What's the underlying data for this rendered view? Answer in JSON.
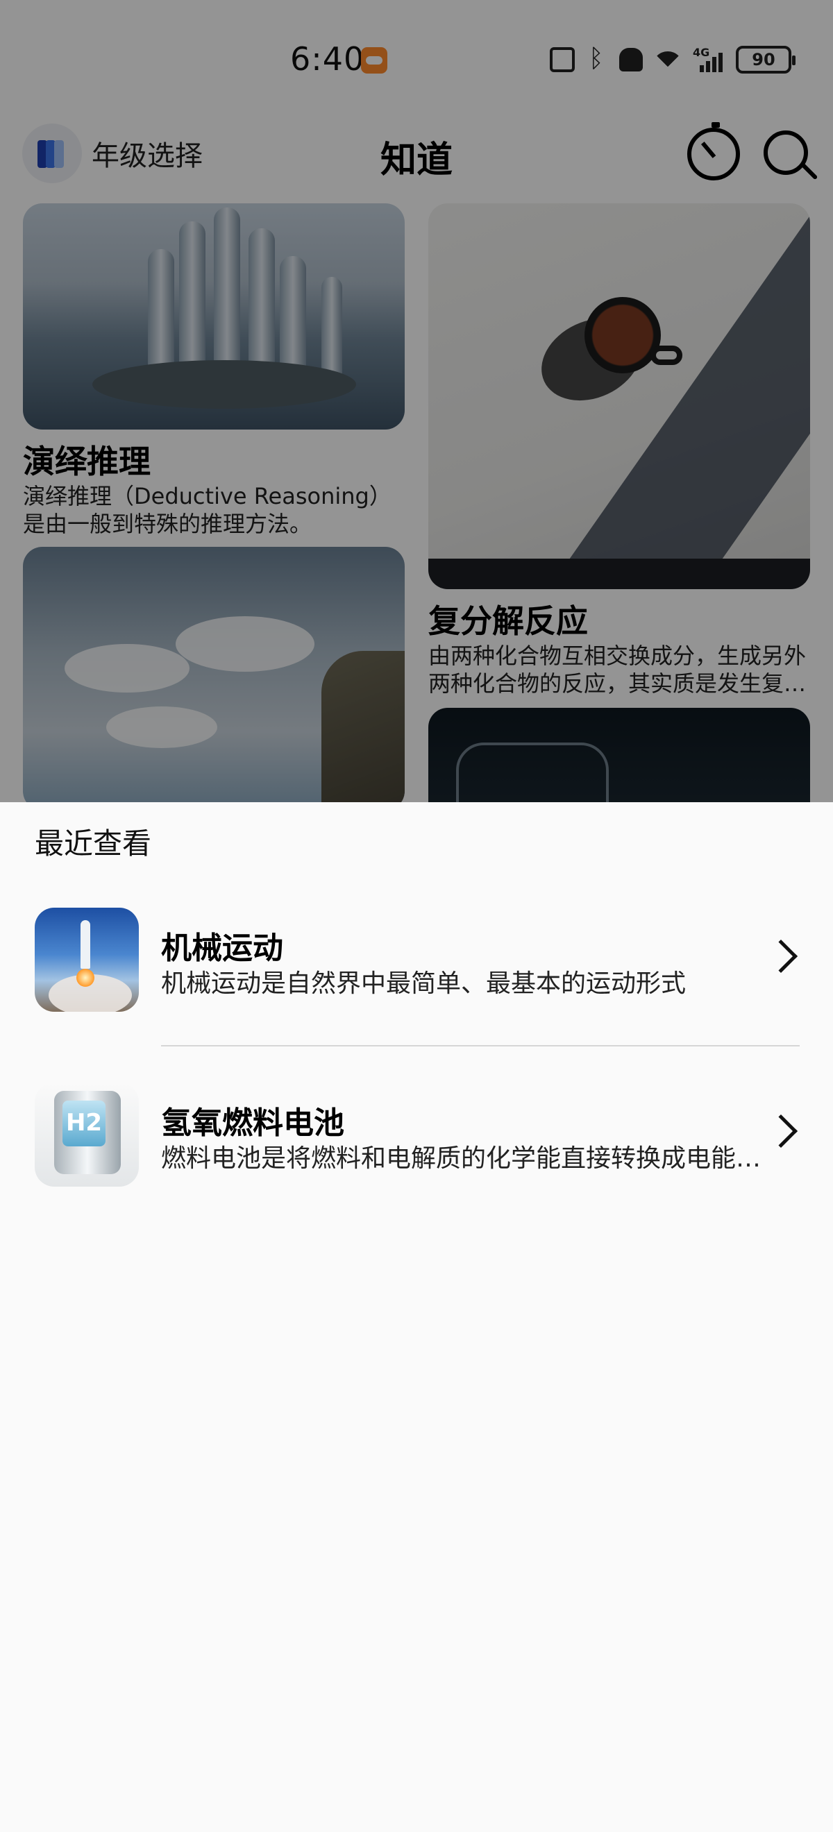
{
  "status_bar": {
    "time": "6:40",
    "battery": "90",
    "network": "4G",
    "icons": [
      "game-icon",
      "nfc-icon",
      "bluetooth-icon",
      "mute-icon",
      "wifi-icon",
      "signal-icon",
      "battery-icon"
    ]
  },
  "topbar": {
    "grade_select_label": "年级选择",
    "title": "知道",
    "icons": [
      "grade-select-icon",
      "timer-icon",
      "search-icon"
    ]
  },
  "cards": [
    {
      "title": "演绎推理",
      "desc": "演绎推理（Deductive Reasoning）是由一般到特殊的推理方法。",
      "image": "architecture-photo"
    },
    {
      "title": "复分解反应",
      "desc": "由两种化合物互相交换成分，生成另外两种化合物的反应，其实质是发生复分解反应的两种物质在水溶液中相互交换离子",
      "image": "coffee-cup-photo"
    },
    {
      "title": "",
      "desc": "",
      "image": "sky-soldier-photo"
    },
    {
      "title": "",
      "desc": "",
      "image": "glass-photo"
    }
  ],
  "sheet": {
    "title": "最近查看",
    "items": [
      {
        "title": "机械运动",
        "desc": "机械运动是自然界中最简单、最基本的运动形式",
        "thumb": "rocket-launch-image"
      },
      {
        "title": "氢氧燃料电池",
        "desc": "燃料电池是将燃料和电解质的化学能直接转换成电能的装置",
        "thumb": "hydrogen-fuel-cell-image",
        "thumb_text": "H2"
      }
    ]
  },
  "colors": {
    "scrim": "#000000",
    "sheet_bg": "#fafafa",
    "accent_orange": "#ff8a2b",
    "grade_icon_blue": "#3b74e8"
  }
}
